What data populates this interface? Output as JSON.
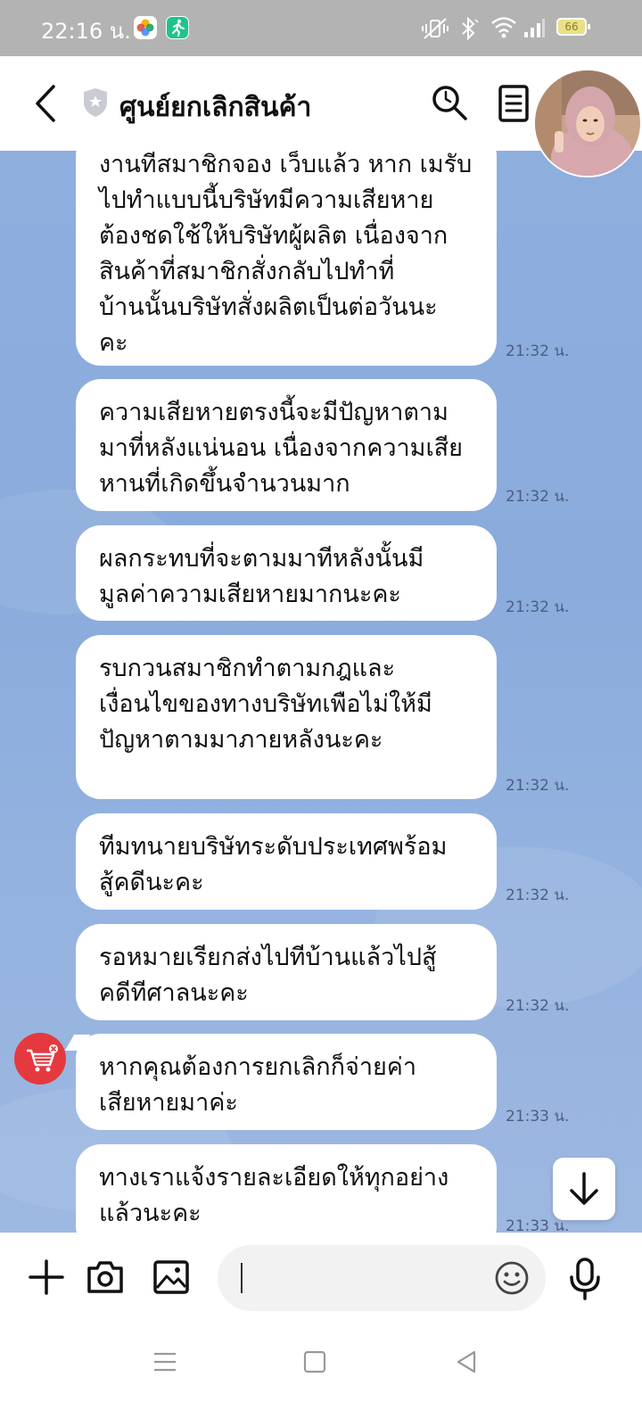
{
  "status_bar": {
    "time": "22:16 น.",
    "battery": "66",
    "icons": [
      "photos-app-icon",
      "fitness-app-icon",
      "mute-vibrate-icon",
      "bluetooth-icon",
      "wifi-icon",
      "signal-icon",
      "battery-icon"
    ]
  },
  "header": {
    "title": "ศูนย์ยกเลิกสินค้า",
    "icons": [
      "back-icon",
      "shield-icon",
      "search-icon",
      "menu-icon",
      "avatar"
    ]
  },
  "messages": [
    {
      "text": "งานที่สมาชิกจอง เว็บแล้ว หาก เมรับ\nไปทำแบบนี้บริษัทมีความเสียหาย\nต้องชดใช้ให้บริษัทผู้ผลิต เนื่องจาก\nสินค้าที่สมาชิกสั่งกลับไปทำที่\nบ้านนั้นบริษัทสั่งผลิตเป็นต่อวันนะ\nคะ",
      "time": "21:32 น."
    },
    {
      "text": "ความเสียหายตรงนี้จะมีปัญหาตาม\nมาที่หลังแน่นอน เนื่องจากความเสีย\nหานที่เกิดขึ้นจำนวนมาก",
      "time": "21:32 น."
    },
    {
      "text": "ผลกระทบที่จะตามมาทีหลังนั้นมี\nมูลค่าความเสียหายมากนะคะ",
      "time": "21:32 น."
    },
    {
      "text": "รบกวนสมาชิกทำตามกฎและ\nเงื่อนไขของทางบริษัทเพือไม่ให้มี\nปัญหาตามมาภายหลังนะคะ",
      "time": "21:32 น."
    },
    {
      "text": "ทีมทนายบริษัทระดับประเทศพร้อม\nสู้คดีนะคะ",
      "time": "21:32 น."
    },
    {
      "text": "รอหมายเรียกส่งไปทีบ้านแล้วไปสู้\nคดีทีศาลนะคะ",
      "time": "21:32 น."
    },
    {
      "text": "หากคุณต้องการยกเลิกก็จ่ายค่า\nเสียหายมาค่ะ",
      "time": "21:33 น."
    },
    {
      "text": "ทางเราแจ้งรายละเอียดให้ทุกอย่าง\nแล้วนะคะ",
      "time": "21:33 น."
    }
  ],
  "input_bar": {
    "placeholder": "",
    "icons": [
      "add-icon",
      "camera-icon",
      "image-icon",
      "emoji-icon",
      "microphone-icon"
    ]
  },
  "nav_bar": {
    "icons": [
      "recent-apps-icon",
      "home-icon",
      "back-nav-icon"
    ]
  }
}
